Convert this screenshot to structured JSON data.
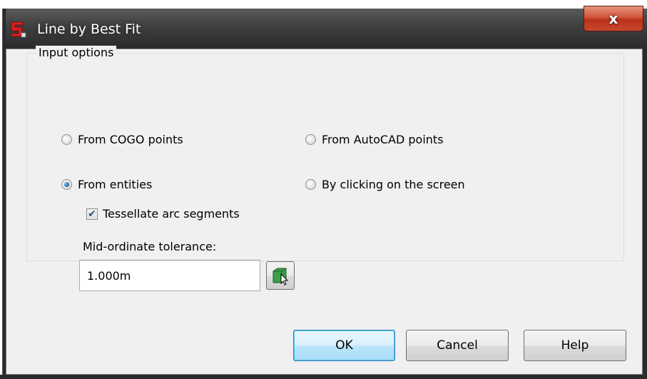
{
  "window": {
    "title": "Line by Best Fit",
    "close_label": "x"
  },
  "input_options": {
    "group_label": "Input options",
    "radios": [
      {
        "label": "From COGO points",
        "checked": false
      },
      {
        "label": "From AutoCAD points",
        "checked": false
      },
      {
        "label": "From entities",
        "checked": true
      },
      {
        "label": "By clicking on the screen",
        "checked": false
      }
    ],
    "tessellate": {
      "label": "Tessellate arc segments",
      "checked": true
    },
    "tolerance": {
      "label": "Mid-ordinate tolerance:",
      "value": "1.000m"
    }
  },
  "buttons": {
    "ok": "OK",
    "cancel": "Cancel",
    "help": "Help"
  },
  "colors": {
    "title_bar": "#3b3b3b",
    "close_button": "#c9472c",
    "dialog_bg": "#f0f0f0",
    "default_button": "#bee6fd",
    "radio_selected": "#1c6fb8"
  }
}
